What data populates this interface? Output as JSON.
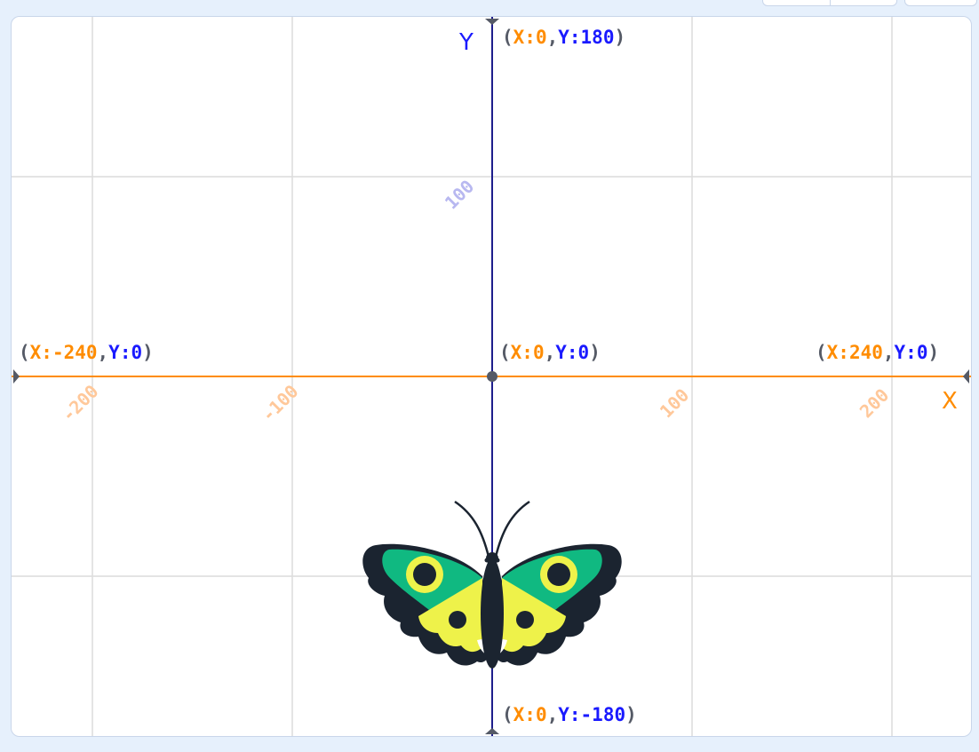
{
  "colors": {
    "x_axis": "#ff8c00",
    "y_axis": "#1e1e8c",
    "grid": "#dcdcdc",
    "x_tick": "#ffc89a",
    "y_tick": "#b8b8f0",
    "x_text": "#ff8c00",
    "y_text": "#1a1aff",
    "wing_green": "#10b981",
    "wing_yellow": "#eef24a",
    "butterfly_dark": "#1b2430"
  },
  "axes": {
    "x_label": "X",
    "y_label": "Y"
  },
  "coordinates": {
    "top": {
      "x_label": "X:0",
      "y_label": "Y:180"
    },
    "bottom": {
      "x_label": "X:0",
      "y_label": "Y:-180"
    },
    "left": {
      "x_label": "X:-240",
      "y_label": "Y:0"
    },
    "center": {
      "x_label": "X:0",
      "y_label": "Y:0"
    },
    "right": {
      "x_label": "X:240",
      "y_label": "Y:0"
    }
  },
  "x_ticks": [
    {
      "value": -200,
      "label": "-200"
    },
    {
      "value": -100,
      "label": "-100"
    },
    {
      "value": 100,
      "label": "100"
    },
    {
      "value": 200,
      "label": "200"
    }
  ],
  "y_ticks": [
    {
      "value": 100,
      "label": "100"
    }
  ],
  "sprite": {
    "name": "butterfly-sprite-icon"
  }
}
